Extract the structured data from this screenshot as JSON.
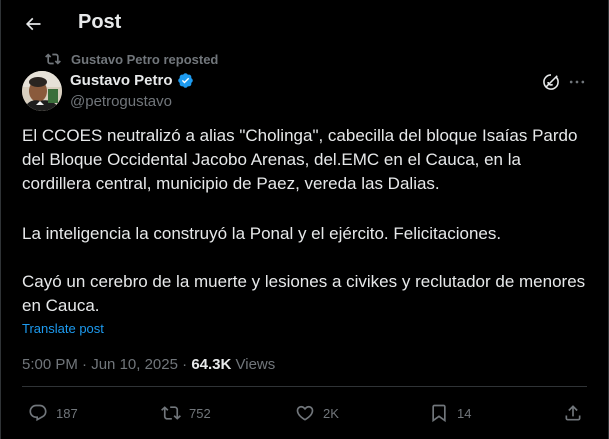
{
  "header": {
    "title": "Post"
  },
  "repost": {
    "label": "Gustavo Petro reposted"
  },
  "author": {
    "name": "Gustavo Petro",
    "handle": "@petrogustavo"
  },
  "tweet": {
    "paragraph1": "El CCOES neutralizó a alias \"Cholinga\", cabecilla del bloque Isaías Pardo del Bloque Occidental Jacobo Arenas, del.EMC en el Cauca, en la cordillera central, municipio de Paez, vereda las Dalias.",
    "paragraph2": "La inteligencia la construyó la Ponal y el ejército. Felicitaciones.",
    "paragraph3": "Cayó un cerebro de la muerte y lesiones a civikes y reclutador de menores en Cauca.",
    "translate": "Translate post"
  },
  "meta": {
    "time": "5:00 PM",
    "sep": "·",
    "date": "Jun 10, 2025",
    "views_count": "64.3K",
    "views_label": "Views"
  },
  "actions": {
    "replies": "187",
    "reposts": "752",
    "likes": "2K",
    "bookmarks": "14"
  },
  "colors": {
    "background": "#000000",
    "text": "#e7e9ea",
    "muted": "#71767b",
    "link": "#1d9bf0",
    "verified": "#1d9bf0"
  },
  "icons": [
    "back-arrow-icon",
    "repost-icon",
    "verified-badge-icon",
    "grok-icon",
    "more-icon",
    "reply-icon",
    "like-icon",
    "bookmark-icon",
    "share-icon"
  ]
}
